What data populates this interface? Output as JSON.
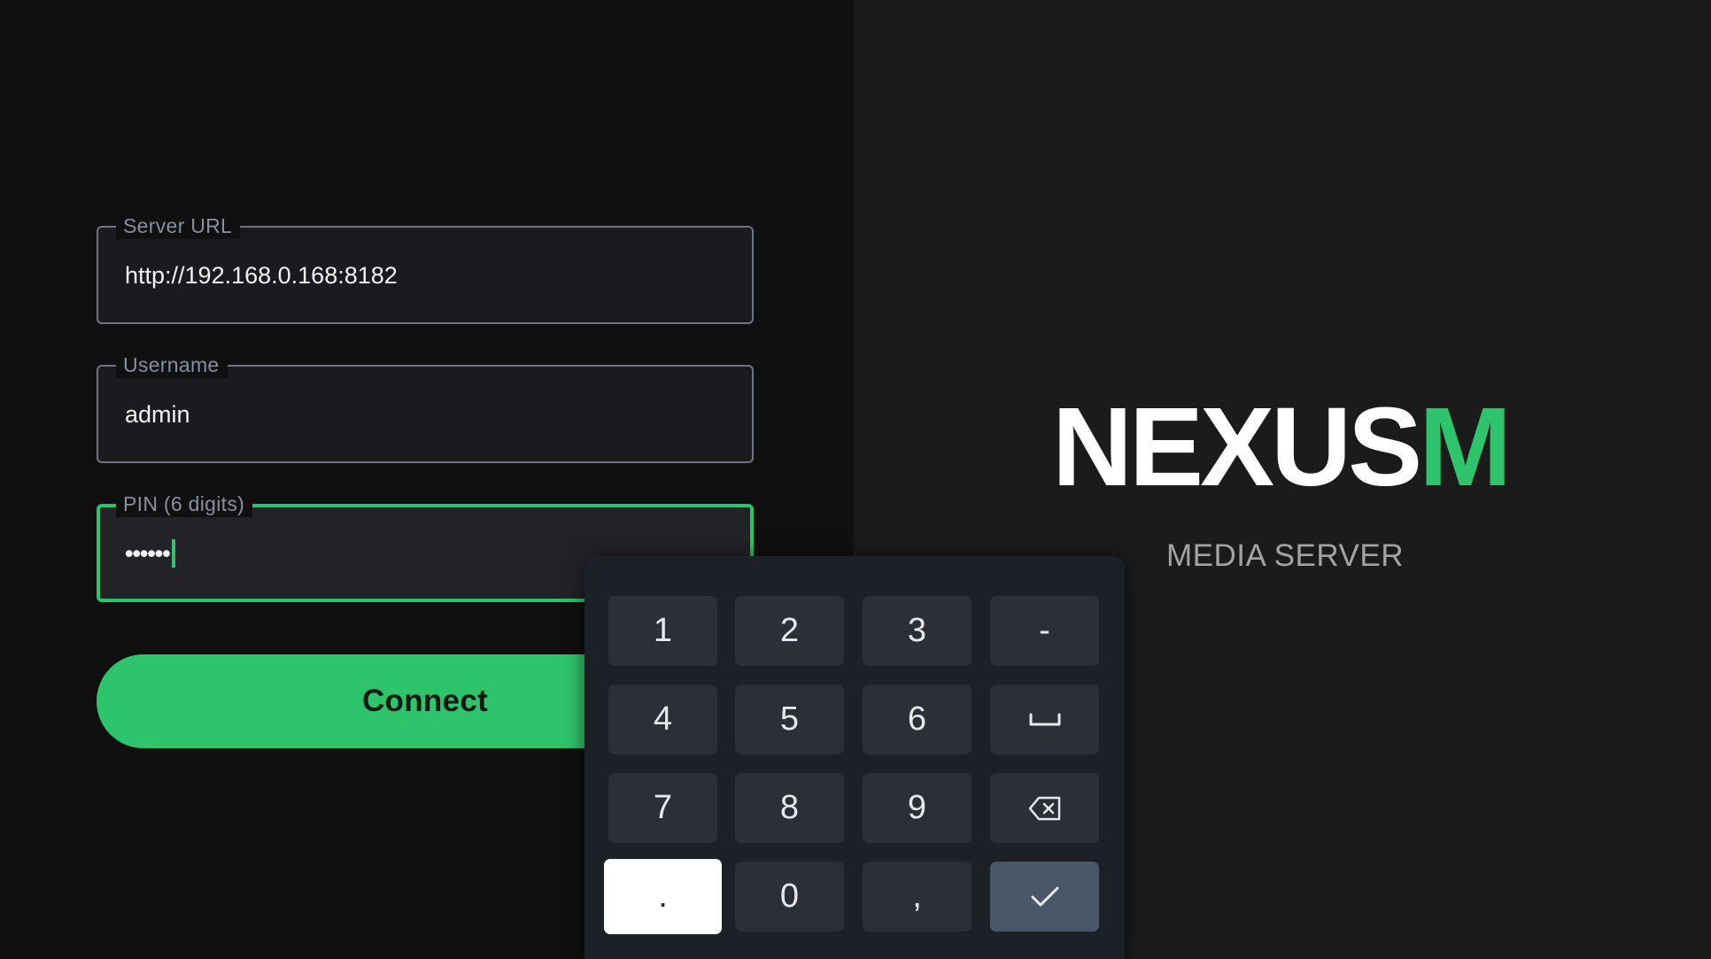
{
  "login_form": {
    "server_url": {
      "label": "Server URL",
      "value": "http://192.168.0.168:8182"
    },
    "username": {
      "label": "Username",
      "value": "admin"
    },
    "pin": {
      "label": "PIN (6 digits)",
      "masked_value": "••••••",
      "focused": true
    },
    "connect_label": "Connect"
  },
  "brand": {
    "logo_main": "NEXUS",
    "logo_accent": "M",
    "tagline": "MEDIA SERVER",
    "accent_color": "#2ec46b"
  },
  "keypad": {
    "rows": [
      [
        "1",
        "2",
        "3",
        "-"
      ],
      [
        "4",
        "5",
        "6",
        "space-icon"
      ],
      [
        "7",
        "8",
        "9",
        "backspace-icon"
      ],
      [
        ".",
        "0",
        ",",
        "check-icon"
      ]
    ],
    "keys": {
      "k1": "1",
      "k2": "2",
      "k3": "3",
      "dash": "-",
      "k4": "4",
      "k5": "5",
      "k6": "6",
      "k7": "7",
      "k8": "8",
      "k9": "9",
      "dot": ".",
      "k0": "0",
      "comma": ","
    },
    "selected_key": "."
  }
}
